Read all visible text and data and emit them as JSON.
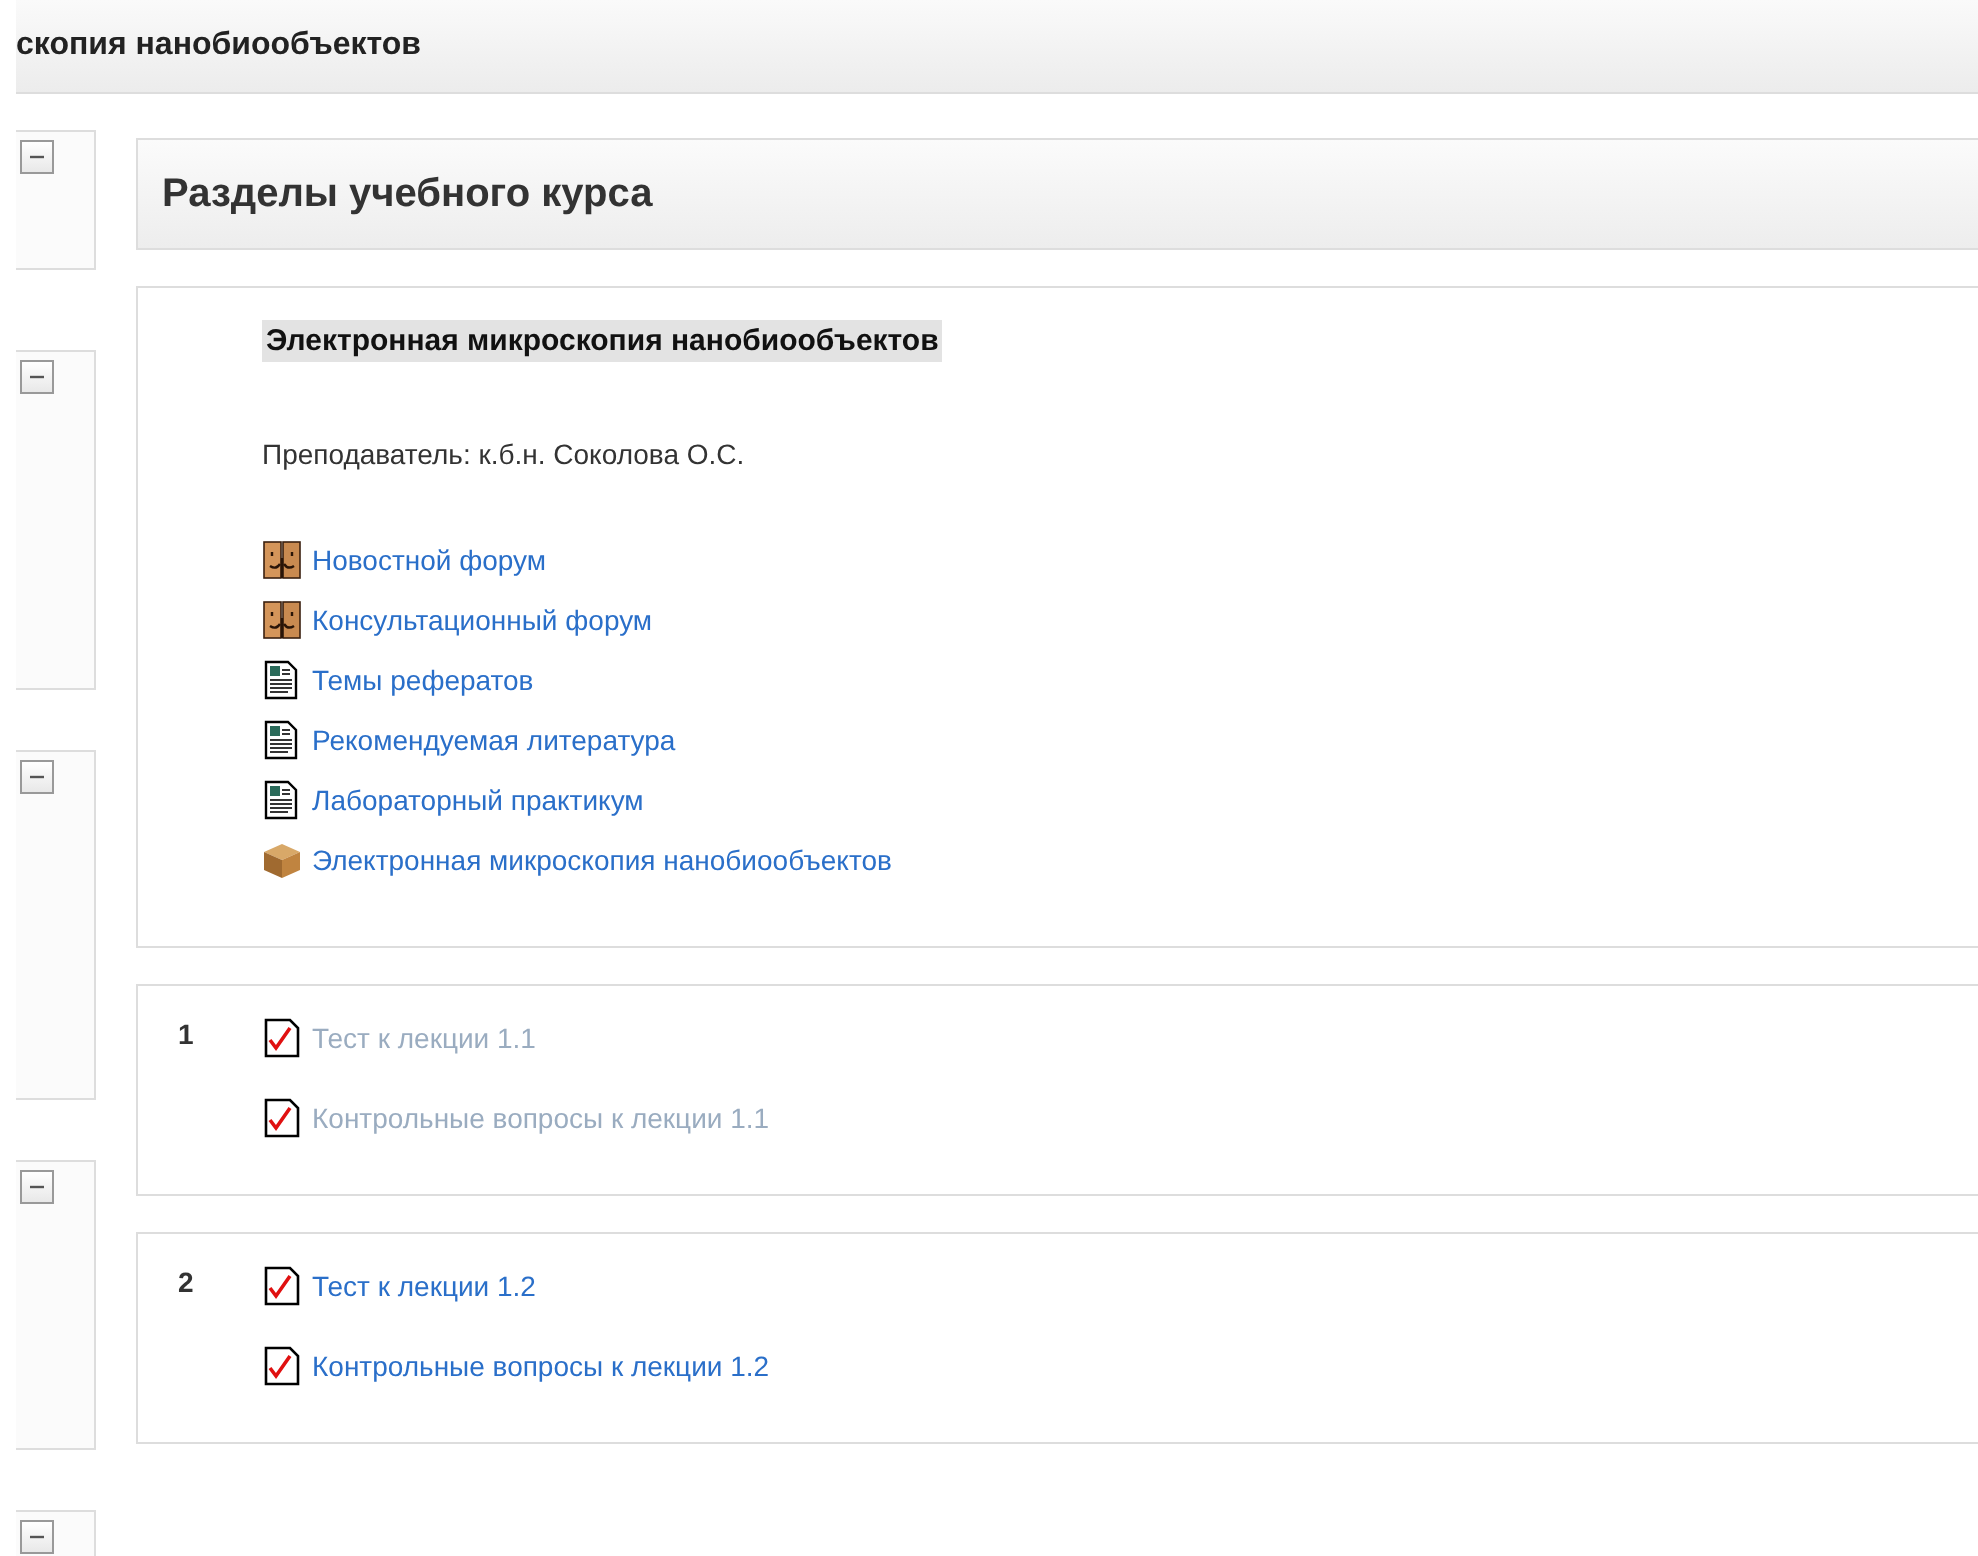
{
  "page_title": "скопия нанобиообъектов",
  "side_blocks": [
    {
      "expanded": true
    },
    {
      "expanded": true
    },
    {
      "expanded": true
    },
    {
      "expanded": true
    },
    {
      "expanded": true
    }
  ],
  "heading": "Разделы учебного курса",
  "sections": [
    {
      "title": "Электронная микроскопия нанобиообъектов",
      "teacher": "Преподаватель: к.б.н. Соколова О.С.",
      "items": [
        {
          "kind": "forum",
          "label": "Новостной форум",
          "dimmed": false
        },
        {
          "kind": "forum",
          "label": "Консультационный форум",
          "dimmed": false
        },
        {
          "kind": "resource",
          "label": "Темы рефератов",
          "dimmed": false
        },
        {
          "kind": "resource",
          "label": "Рекомендуемая литература",
          "dimmed": false
        },
        {
          "kind": "resource",
          "label": "Лабораторный практикум",
          "dimmed": false
        },
        {
          "kind": "package",
          "label": "Электронная микроскопия нанобиообъектов",
          "dimmed": false
        }
      ]
    },
    {
      "number": "1",
      "items": [
        {
          "kind": "quiz",
          "label": "Тест к лекции 1.1",
          "dimmed": true
        },
        {
          "kind": "quiz",
          "label": "Контрольные вопросы к лекции 1.1",
          "dimmed": true
        }
      ]
    },
    {
      "number": "2",
      "items": [
        {
          "kind": "quiz",
          "label": "Тест к лекции 1.2",
          "dimmed": false
        },
        {
          "kind": "quiz",
          "label": "Контрольные вопросы к лекции 1.2",
          "dimmed": false
        }
      ]
    }
  ]
}
